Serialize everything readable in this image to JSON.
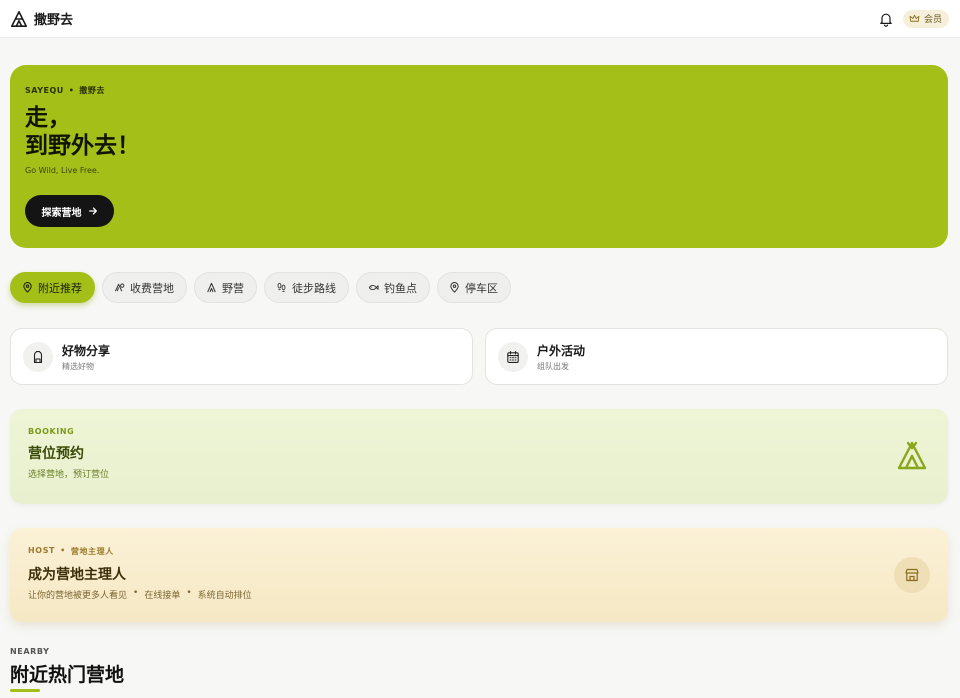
{
  "header": {
    "brand": "撒野去",
    "member_label": "会员"
  },
  "hero": {
    "kicker_en": "SAYEQU",
    "kicker_dot": "•",
    "kicker_cn": "撒野去",
    "title_line1": "走，",
    "title_line2": "到野外去！",
    "subtitle": "Go Wild, Live Free.",
    "cta_label": "探索营地",
    "bg_color": "#a3bf18"
  },
  "chips": [
    {
      "label": "附近推荐",
      "icon": "map-pin-icon",
      "active": true
    },
    {
      "label": "收费营地",
      "icon": "tent-coin-icon",
      "active": false
    },
    {
      "label": "野营",
      "icon": "camping-icon",
      "active": false
    },
    {
      "label": "徒步路线",
      "icon": "footprints-icon",
      "active": false
    },
    {
      "label": "钓鱼点",
      "icon": "fish-icon",
      "active": false
    },
    {
      "label": "停车区",
      "icon": "map-pin-icon",
      "active": false
    }
  ],
  "features": [
    {
      "title": "好物分享",
      "subtitle": "精选好物",
      "icon": "backpack-icon"
    },
    {
      "title": "户外活动",
      "subtitle": "组队出发",
      "icon": "calendar-icon"
    }
  ],
  "booking": {
    "kicker": "BOOKING",
    "title": "营位预约",
    "subtitle": "选择营地，预订营位",
    "icon": "tent-icon"
  },
  "host": {
    "kicker_en": "HOST",
    "kicker_dot": "•",
    "kicker_cn": "营地主理人",
    "title": "成为营地主理人",
    "sub_1": "让你的营地被更多人看见",
    "sub_dot1": "•",
    "sub_2": "在线接单",
    "sub_dot2": "•",
    "sub_3": "系统自动排位",
    "icon": "store-icon"
  },
  "nearby": {
    "kicker": "NEARBY",
    "title": "附近热门营地"
  },
  "colors": {
    "accent": "#a3bf18",
    "booking_bg": "#eef5d6",
    "host_bg": "#fbf1d6"
  }
}
